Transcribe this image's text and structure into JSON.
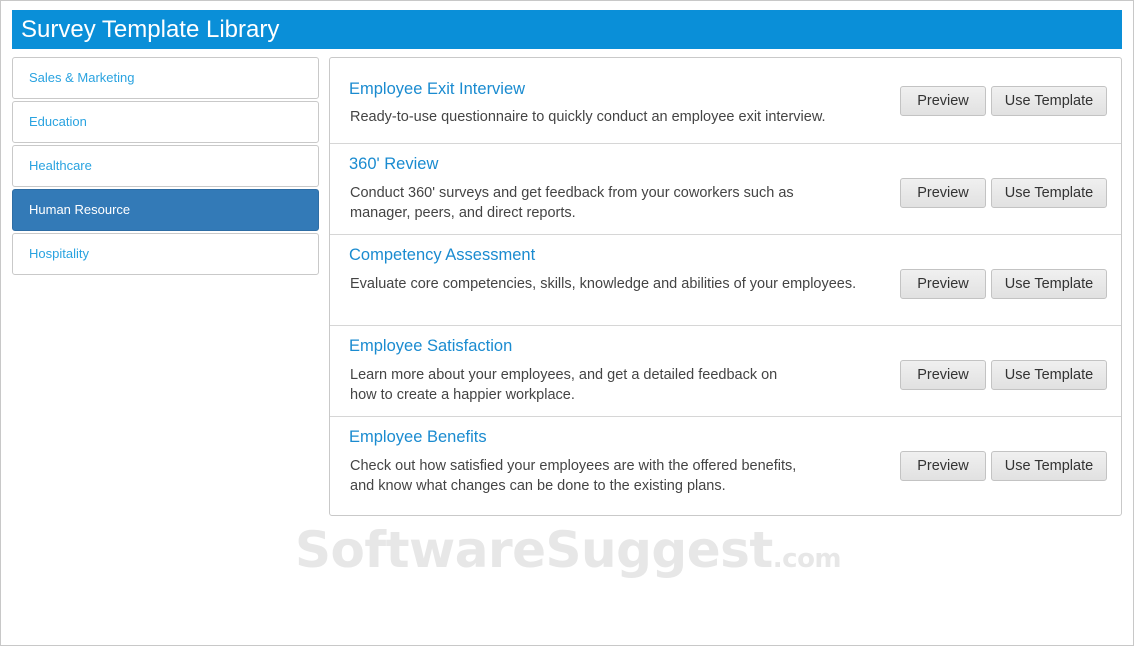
{
  "header": {
    "title": "Survey Template Library"
  },
  "sidebar": {
    "items": [
      {
        "label": "Sales & Marketing",
        "active": false
      },
      {
        "label": "Education",
        "active": false
      },
      {
        "label": "Healthcare",
        "active": false
      },
      {
        "label": "Human Resource",
        "active": true
      },
      {
        "label": "Hospitality",
        "active": false
      }
    ]
  },
  "templates": [
    {
      "title": "Employee Exit Interview",
      "desc1": "Ready-to-use questionnaire to quickly conduct an employee exit interview.",
      "desc2": "",
      "preview": "Preview",
      "use": "Use Template"
    },
    {
      "title": "360' Review",
      "desc1": "Conduct 360' surveys and get feedback from your coworkers such as",
      "desc2": "manager, peers, and direct reports.",
      "preview": "Preview",
      "use": "Use Template"
    },
    {
      "title": "Competency Assessment",
      "desc1": "Evaluate core competencies, skills, knowledge and abilities of your employees.",
      "desc2": "",
      "preview": "Preview",
      "use": "Use Template"
    },
    {
      "title": "Employee Satisfaction",
      "desc1": "Learn more about your employees, and get a detailed feedback on",
      "desc2": "how to create a happier workplace.",
      "preview": "Preview",
      "use": "Use Template"
    },
    {
      "title": "Employee Benefits",
      "desc1": "Check out how satisfied your employees are with the offered benefits,",
      "desc2": "and know what changes can be done to the existing plans.",
      "preview": "Preview",
      "use": "Use Template"
    }
  ],
  "watermark": {
    "main": "SoftwareSuggest",
    "suffix": ".com"
  },
  "colors": {
    "header_bg": "#0a8fd8",
    "active_item_bg": "#337ab7",
    "link": "#1a8bd0"
  }
}
